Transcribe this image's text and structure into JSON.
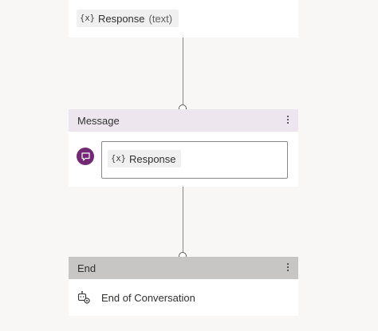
{
  "top_node": {
    "variable": {
      "icon": "{x}",
      "name": "Response",
      "type": "(text)"
    }
  },
  "message_node": {
    "title": "Message",
    "message_icon": "chat-bubble-icon",
    "variable": {
      "icon": "{x}",
      "name": "Response"
    }
  },
  "end_node": {
    "title": "End",
    "icon": "bot-gear-icon",
    "label": "End of Conversation"
  },
  "colors": {
    "canvas": "#f8f7f6",
    "message_header": "#ede6ef",
    "end_header": "#c8c6c4",
    "message_icon_bg": "#742774"
  }
}
